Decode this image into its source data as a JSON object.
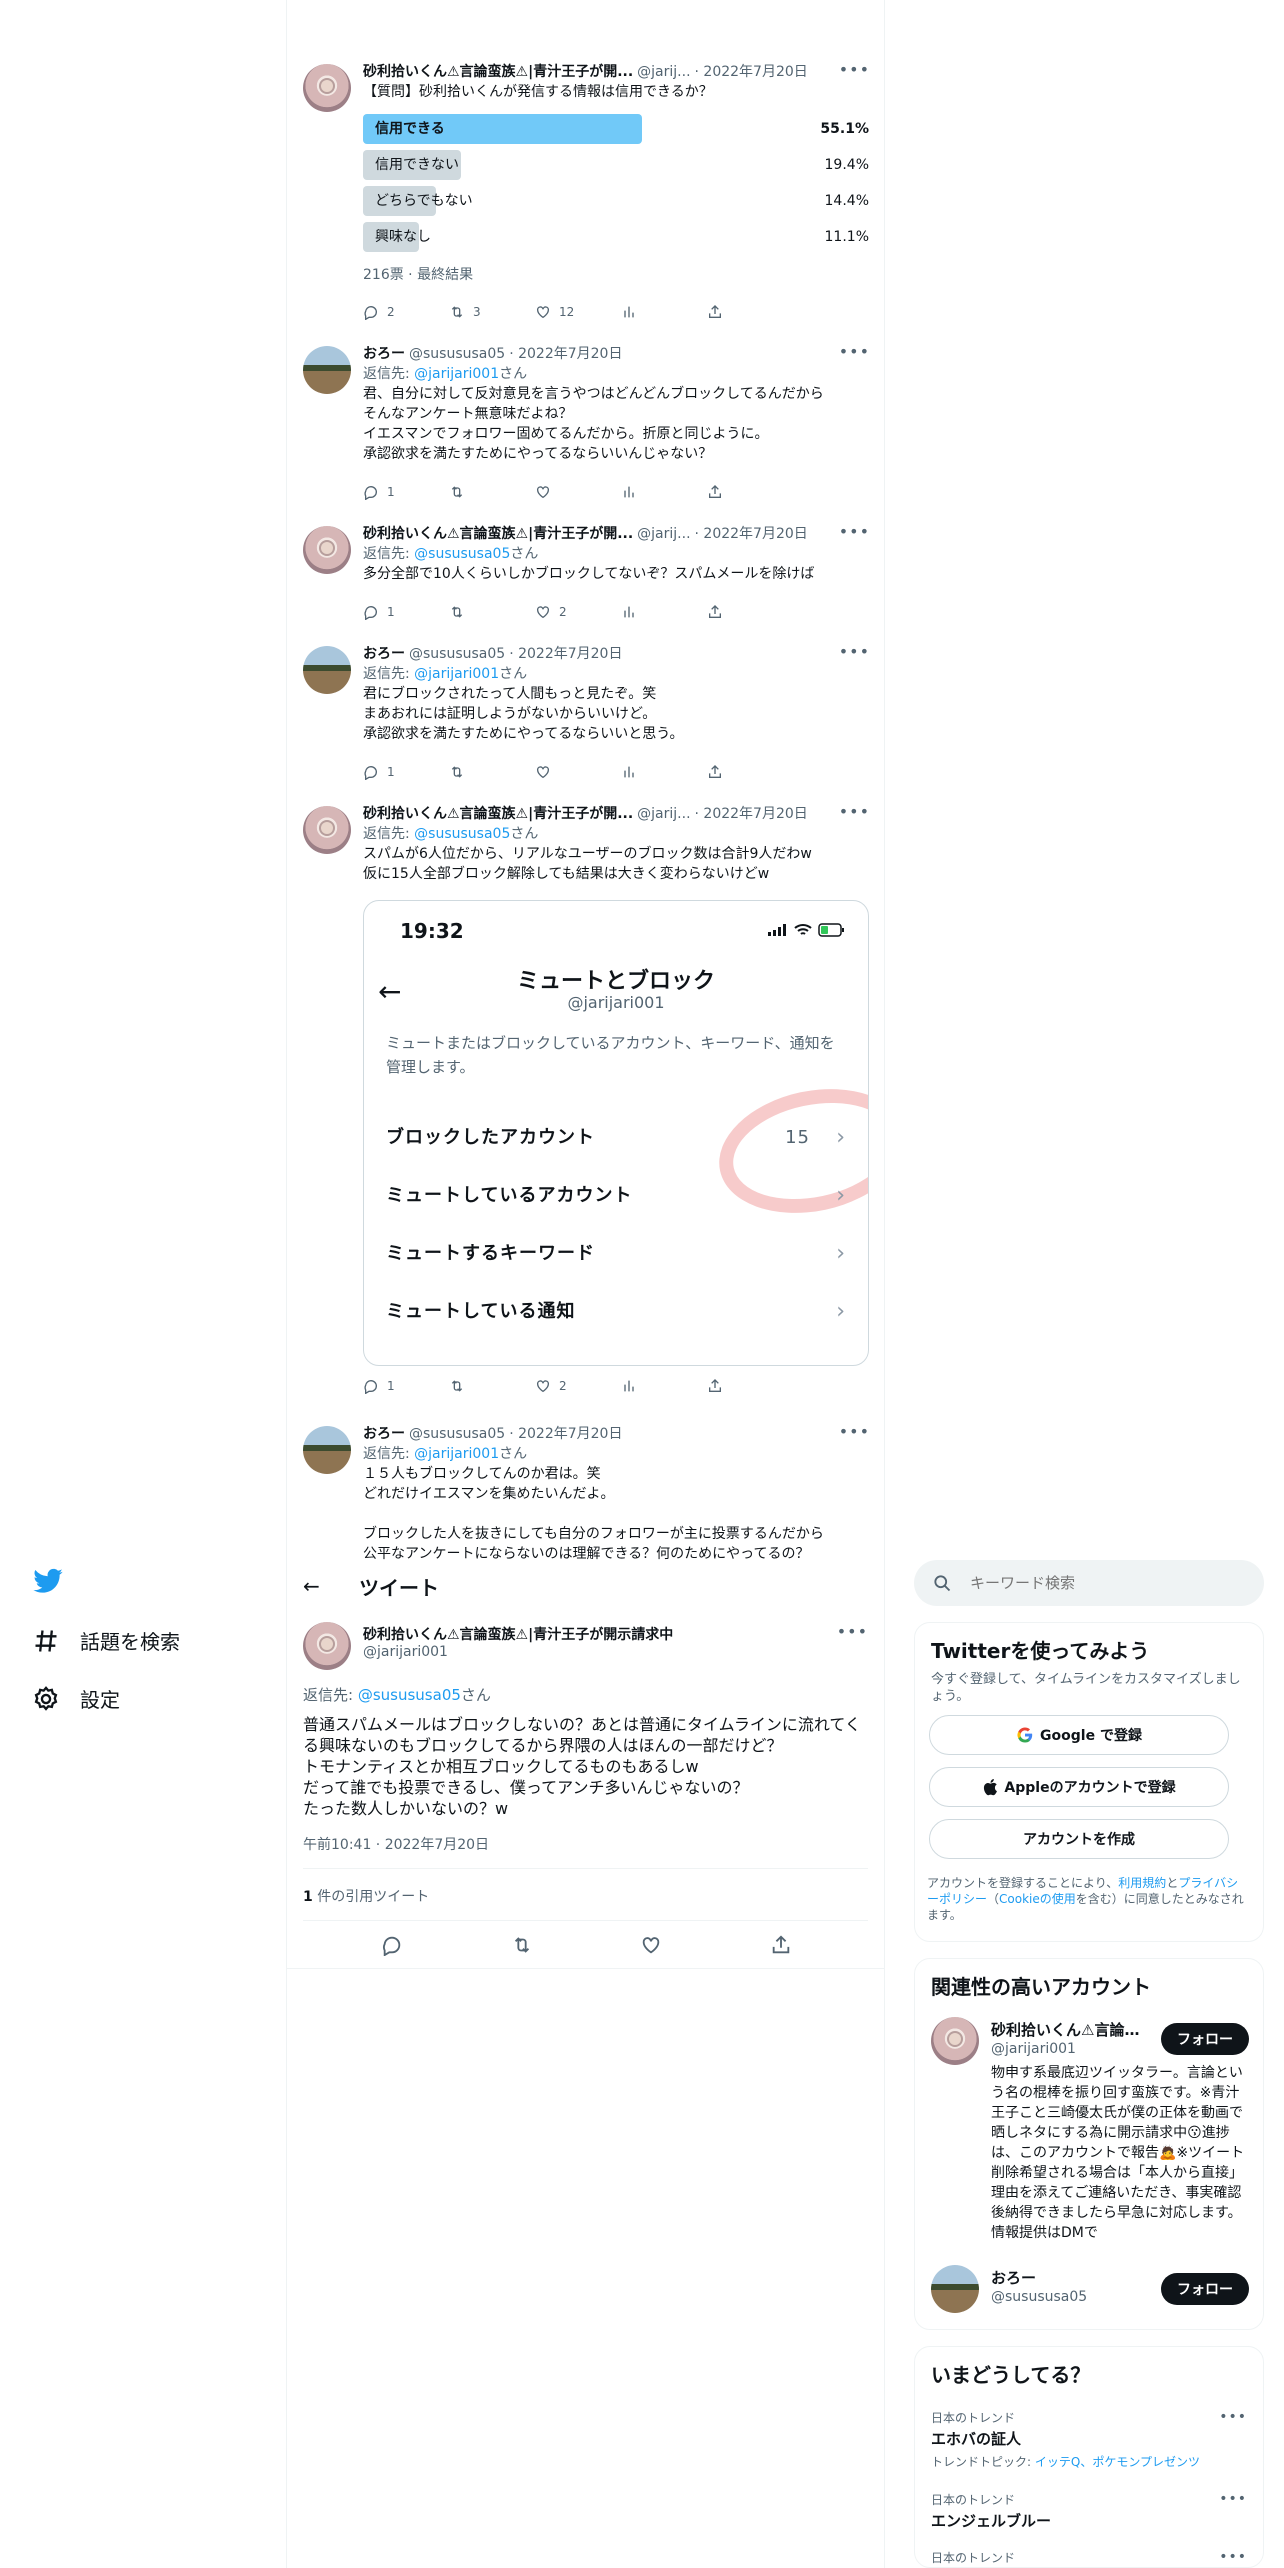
{
  "accent_color": "#1d9bf0",
  "poll_tweet": {
    "name": "砂利拾いくん⚠言論蛮族⚠|青汁王子が開...",
    "handle": "@jarij...",
    "date": "· 2022年7月20日",
    "text": "【質問】砂利拾いくんが発信する情報は信用できるか？",
    "options": [
      {
        "label": "信用できる",
        "percent": "55.1%",
        "value": 55.1
      },
      {
        "label": "信用できない",
        "percent": "19.4%",
        "value": 19.4
      },
      {
        "label": "どちらでもない",
        "percent": "14.4%",
        "value": 14.4
      },
      {
        "label": "興味なし",
        "percent": "11.1%",
        "value": 11.1
      }
    ],
    "summary": "216票 · 最終結果",
    "replies": "2",
    "retweets": "3",
    "likes": "12"
  },
  "replies": [
    {
      "name": "おろー",
      "handle": "@susususa05",
      "date": "· 2022年7月20日",
      "reply_prefix": "返信先:",
      "reply_to": "@jarijari001",
      "reply_suffix": "さん",
      "text": "君、自分に対して反対意見を言うやつはどんどんブロックしてるんだから\nそんなアンケート無意味だよね？\nイエスマンでフォロワー固めてるんだから。折原と同じように。\n承認欲求を満たすためにやってるならいいんじゃない？",
      "replies": "1",
      "retweets": "",
      "likes": ""
    },
    {
      "name": "砂利拾いくん⚠言論蛮族⚠|青汁王子が開...",
      "handle": "@jarij...",
      "date": "· 2022年7月20日",
      "reply_prefix": "返信先:",
      "reply_to": "@susususa05",
      "reply_suffix": "さん",
      "text": "多分全部で10人くらいしかブロックしてないぞ？スパムメールを除けば",
      "replies": "1",
      "retweets": "",
      "likes": "2"
    },
    {
      "name": "おろー",
      "handle": "@susususa05",
      "date": "· 2022年7月20日",
      "reply_prefix": "返信先:",
      "reply_to": "@jarijari001",
      "reply_suffix": "さん",
      "text": "君にブロックされたって人間もっと見たぞ。笑\nまあおれには証明しようがないからいいけど。\n承認欲求を満たすためにやってるならいいと思う。",
      "replies": "1",
      "retweets": "",
      "likes": ""
    },
    {
      "name": "砂利拾いくん⚠言論蛮族⚠|青汁王子が開...",
      "handle": "@jarij...",
      "date": "· 2022年7月20日",
      "reply_prefix": "返信先:",
      "reply_to": "@susususa05",
      "reply_suffix": "さん",
      "text": "スパムが6人位だから、リアルなユーザーのブロック数は合計9人だわw\n仮に15人全部ブロック解除しても結果は大きく変わらないけどw",
      "replies": "1",
      "retweets": "",
      "likes": "2"
    },
    {
      "name": "おろー",
      "handle": "@susususa05",
      "date": "· 2022年7月20日",
      "reply_prefix": "返信先:",
      "reply_to": "@jarijari001",
      "reply_suffix": "さん",
      "text": "１５人もブロックしてんのか君は。笑\nどれだけイエスマンを集めたいんだよ。\n\nブロックした人を抜きにしても自分のフォロワーが主に投票するんだから\n公平なアンケートにならないのは理解できる？何のためにやってるの？"
    }
  ],
  "screenshot_card": {
    "time": "19:32",
    "title": "ミュートとブロック",
    "handle": "@jarijari001",
    "description": "ミュートまたはブロックしているアカウント、キーワード、通知を管理します。",
    "rows": [
      {
        "label": "ブロックしたアカウント",
        "count": "15"
      },
      {
        "label": "ミュートしているアカウント",
        "count": ""
      },
      {
        "label": "ミュートするキーワード",
        "count": ""
      },
      {
        "label": "ミュートしている通知",
        "count": ""
      }
    ]
  },
  "nav": {
    "explore": "話題を検索",
    "settings": "設定"
  },
  "main": {
    "header": "ツイート",
    "name": "砂利拾いくん⚠言論蛮族⚠|青汁王子が開示請求中",
    "handle": "@jarijari001",
    "reply_prefix": "返信先:",
    "reply_to": "@susususa05",
    "reply_suffix": "さん",
    "text": "普通スパムメールはブロックしないの？あとは普通にタイムラインに流れてくる興味ないのもブロックしてるから界隈の人はほんの一部だけど？\nトモナンティスとか相互ブロックしてるものもあるしw\nだって誰でも投票できるし、僕ってアンチ多いんじゃないの？\nたった数人しかいないの？w",
    "timestamp": "午前10:41 · 2022年7月20日",
    "quote_count": "1",
    "quote_label": "件の引用ツイート"
  },
  "search": {
    "placeholder": "キーワード検索"
  },
  "signup": {
    "title": "Twitterを使ってみよう",
    "lead": "今すぐ登録して、タイムラインをカスタマイズしましょう。",
    "google": "Google で登録",
    "apple": "Appleのアカウントで登録",
    "create": "アカウントを作成",
    "terms_1": "アカウントを登録することにより、",
    "terms_link1": "利用規約",
    "terms_2": "と",
    "terms_link2": "プライバシーポリシー",
    "terms_3": "（",
    "terms_link3": "Cookieの使用",
    "terms_4": "を含む）に同意したとみなされます。"
  },
  "related": {
    "title": "関連性の高いアカウント",
    "accounts": [
      {
        "name": "砂利拾いくん⚠言論...",
        "handle": "@jarijari001",
        "follow": "フォロー",
        "bio": "物申す系最底辺ツイッタラー。言論という名の棍棒を振り回す蛮族です。※青汁王子こと三崎優太氏が僕の正体を動画で晒しネタにする為に開示請求中😗進捗は、このアカウントで報告🙇※ツイート削除希望される場合は「本人から直接」理由を添えてご連絡いただき、事実確認後納得できましたら早急に対応します。情報提供はDMで"
      },
      {
        "name": "おろー",
        "handle": "@susususa05",
        "follow": "フォロー"
      }
    ]
  },
  "trends": {
    "title": "いまどうしてる？",
    "items": [
      {
        "category": "日本のトレンド",
        "name": "エホバの証人",
        "topic_prefix": "トレンドトピック:",
        "topic": "イッテQ、ポケモンプレゼンツ"
      },
      {
        "category": "日本のトレンド",
        "name": "エンジェルブルー"
      },
      {
        "category": "日本のトレンド"
      }
    ]
  }
}
